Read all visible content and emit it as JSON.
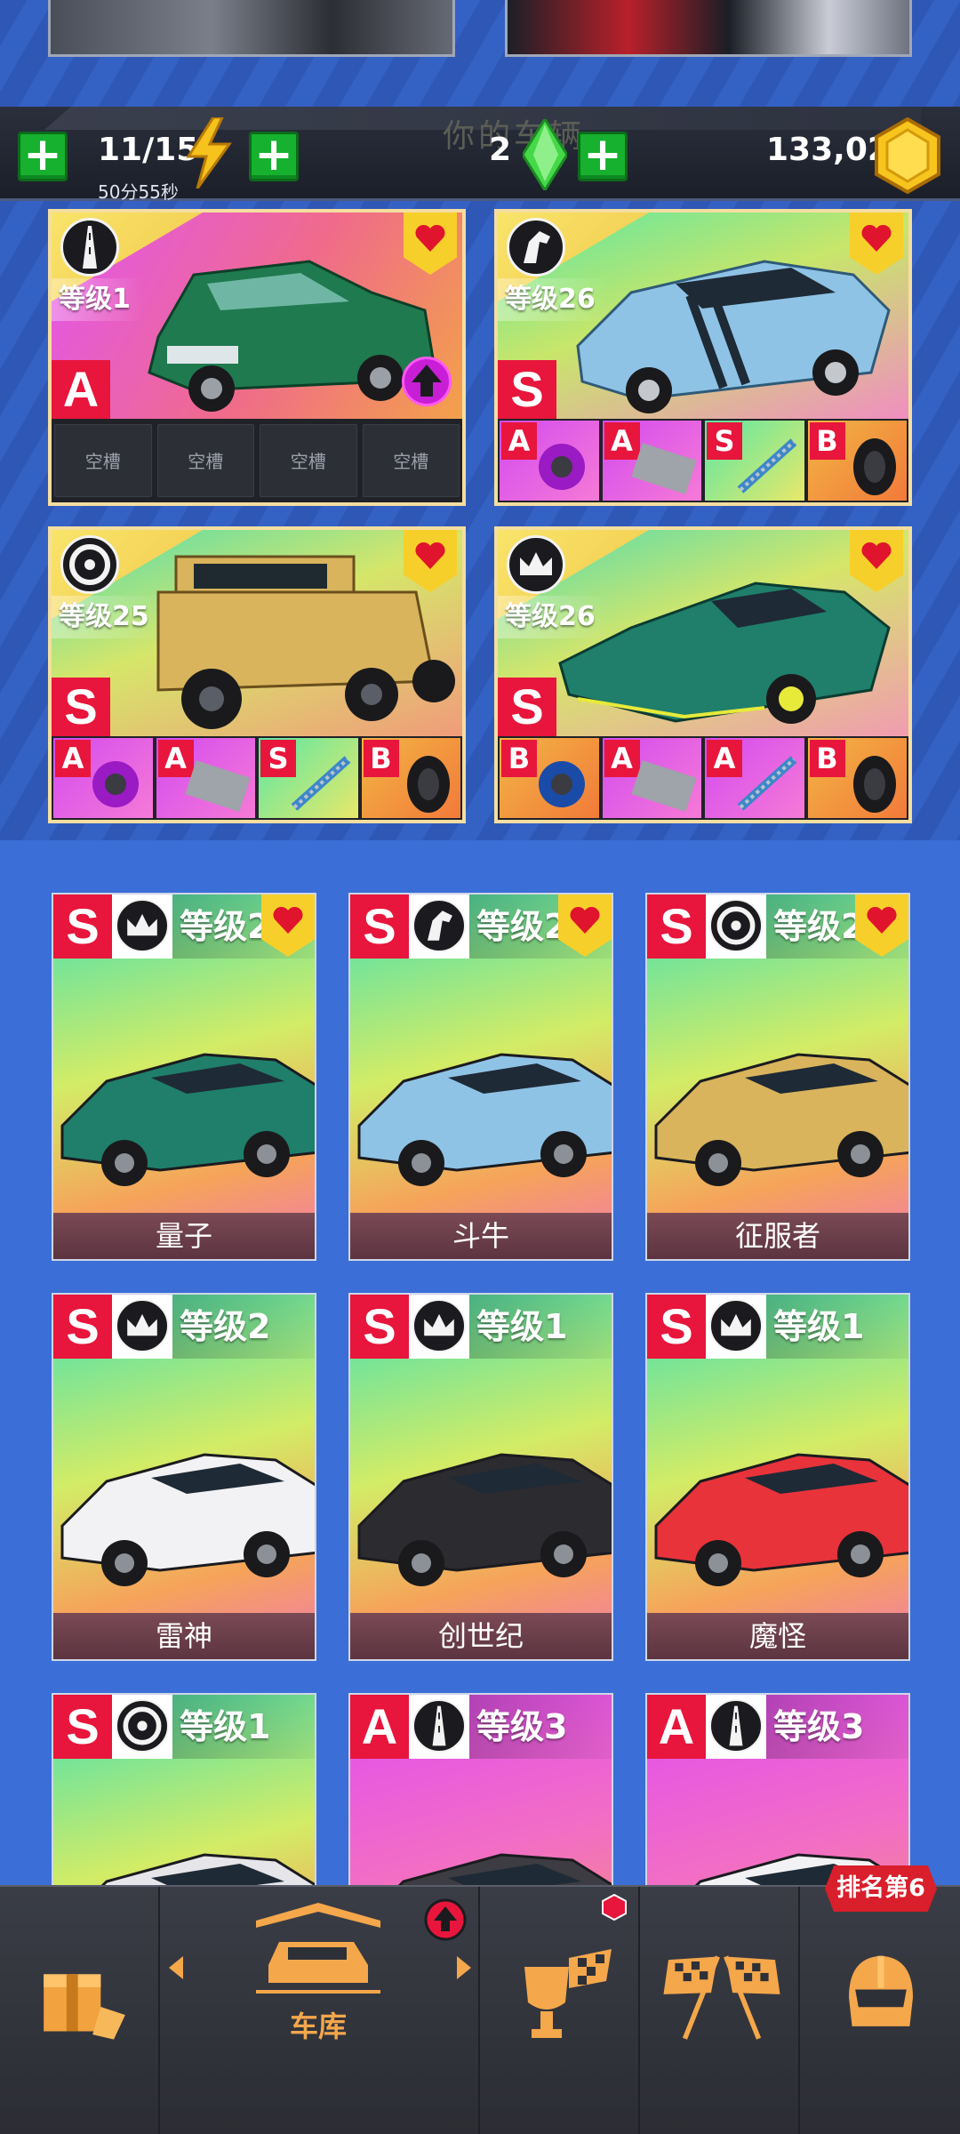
{
  "header": {
    "ghost_title": "你的车辆",
    "energy": "11/15",
    "energy_timer": "50分55秒",
    "gems": "2",
    "coins": "133,023"
  },
  "favorites": [
    {
      "level": "等级1",
      "grade": "A",
      "icon": "road-icon",
      "background": [
        "#e255f0",
        "#f06b8a",
        "#f2a14a"
      ],
      "car_color": "#1f7a4f",
      "slots": [
        "空槽",
        "空槽",
        "空槽",
        "空槽"
      ],
      "has_upgrade": true
    },
    {
      "level": "等级26",
      "grade": "S",
      "icon": "horse-icon",
      "background": [
        "#5be7a4",
        "#c8e66a",
        "#f08ec0"
      ],
      "car_color": "#8fc3e6",
      "parts": [
        {
          "grade": "A",
          "type": "turbo"
        },
        {
          "grade": "A",
          "type": "engine"
        },
        {
          "grade": "S",
          "type": "suspension"
        },
        {
          "grade": "B",
          "type": "tire"
        }
      ]
    },
    {
      "level": "等级25",
      "grade": "S",
      "icon": "wheel-icon",
      "background": [
        "#50dcb0",
        "#d6e66a",
        "#f09c7a"
      ],
      "car_color": "#d9b45c",
      "parts": [
        {
          "grade": "A",
          "type": "turbo"
        },
        {
          "grade": "A",
          "type": "engine"
        },
        {
          "grade": "S",
          "type": "suspension"
        },
        {
          "grade": "B",
          "type": "tire"
        }
      ]
    },
    {
      "level": "等级26",
      "grade": "S",
      "icon": "crown-icon",
      "background": [
        "#50dcb0",
        "#d6e66a",
        "#f09cb0"
      ],
      "car_color": "#1f7f6a",
      "parts": [
        {
          "grade": "B",
          "type": "turbo"
        },
        {
          "grade": "A",
          "type": "engine"
        },
        {
          "grade": "A",
          "type": "suspension"
        },
        {
          "grade": "B",
          "type": "tire"
        }
      ]
    }
  ],
  "garage": [
    {
      "grade": "S",
      "icon": "crown-icon",
      "level": "等级2",
      "name": "量子",
      "favorite": true,
      "car_color": "#1f7f6a"
    },
    {
      "grade": "S",
      "icon": "horse-icon",
      "level": "等级2",
      "name": "斗牛",
      "favorite": true,
      "car_color": "#8fc3e6"
    },
    {
      "grade": "S",
      "icon": "wheel-icon",
      "level": "等级2",
      "name": "征服者",
      "favorite": true,
      "car_color": "#d9b45c"
    },
    {
      "grade": "S",
      "icon": "crown-icon",
      "level": "等级2",
      "name": "雷神",
      "favorite": false,
      "car_color": "#f2f2f4"
    },
    {
      "grade": "S",
      "icon": "crown-icon",
      "level": "等级1",
      "name": "创世纪",
      "favorite": false,
      "car_color": "#2b2b30"
    },
    {
      "grade": "S",
      "icon": "crown-icon",
      "level": "等级1",
      "name": "魔怪",
      "favorite": false,
      "car_color": "#e8333b"
    },
    {
      "grade": "S",
      "icon": "wheel-icon",
      "level": "等级1",
      "name": "",
      "favorite": false,
      "car_color": "#e6e6ea"
    },
    {
      "grade": "A",
      "icon": "road-icon",
      "level": "等级3",
      "name": "",
      "favorite": false,
      "car_color": "#3c3c42"
    },
    {
      "grade": "A",
      "icon": "road-icon",
      "level": "等级3",
      "name": "",
      "favorite": false,
      "car_color": "#f2f2f4"
    }
  ],
  "nav": {
    "garage_label": "车库",
    "rank_tag": "排名第6"
  },
  "colors": {
    "grade_red": "#e8153c",
    "heart_yellow": "#f7cf2a",
    "plus_green": "#16b12e",
    "nav_orange": "#f4a74b",
    "background_blue": "#3b6ed6"
  }
}
